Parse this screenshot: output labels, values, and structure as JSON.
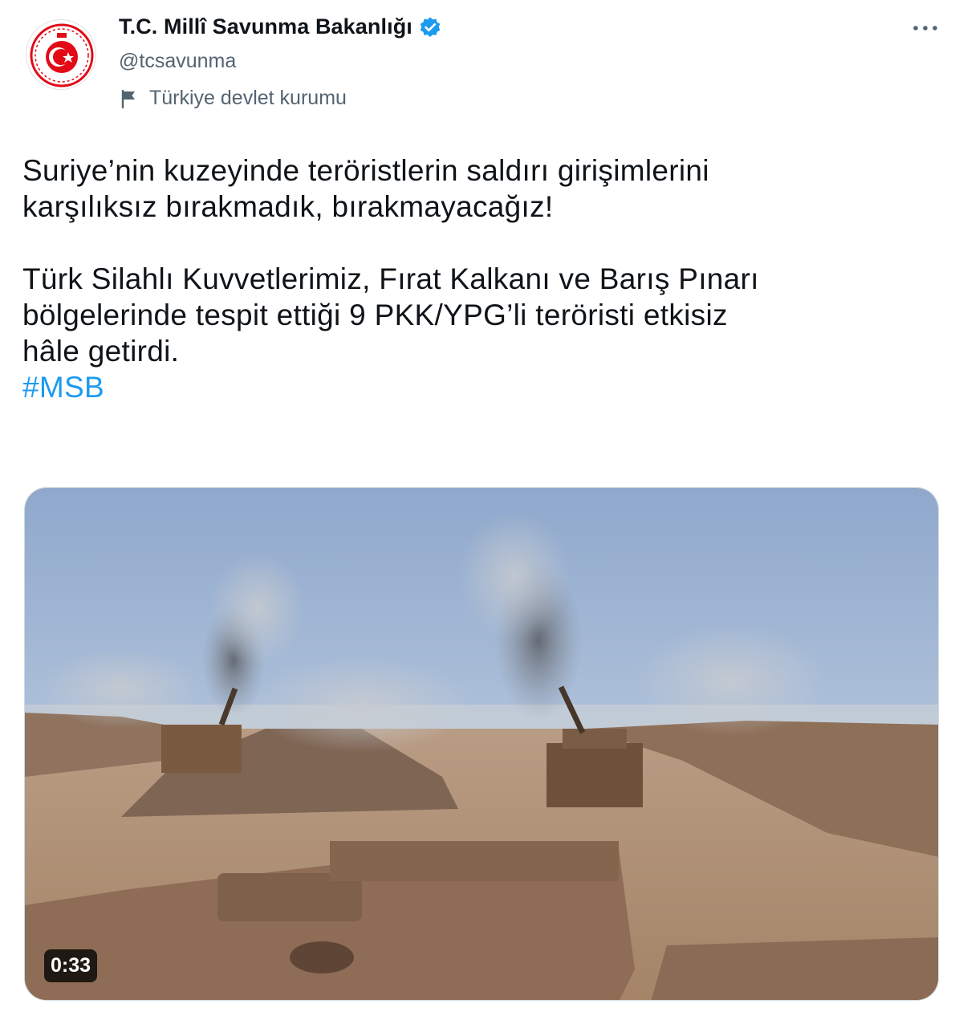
{
  "account": {
    "display_name": "T.C. Millî Savunma Bakanlığı",
    "handle": "@tcsavunma",
    "affiliation_label": "Türkiye devlet kurumu",
    "avatar_icon": "turkish-emblem-icon",
    "verified_icon": "verified-badge-icon"
  },
  "tweet": {
    "line1": "Suriye’nin kuzeyinde teröristlerin saldırı girişimlerini",
    "line2": "karşılıksız bırakmadık, bırakmayacağız!",
    "line3": "Türk Silahlı Kuvvetlerimiz, Fırat Kalkanı ve Barış Pınarı",
    "line4": "bölgelerinde tespit ettiği 9 PKK/YPG’li teröristi etkisiz",
    "line5": "hâle getirdi.",
    "hashtag": "#MSB"
  },
  "media": {
    "type": "video",
    "duration": "0:33"
  },
  "colors": {
    "link": "#1d9bf0",
    "verified": "#1d9bf0",
    "emblem_red": "#e30a17",
    "secondary_text": "#536471"
  }
}
